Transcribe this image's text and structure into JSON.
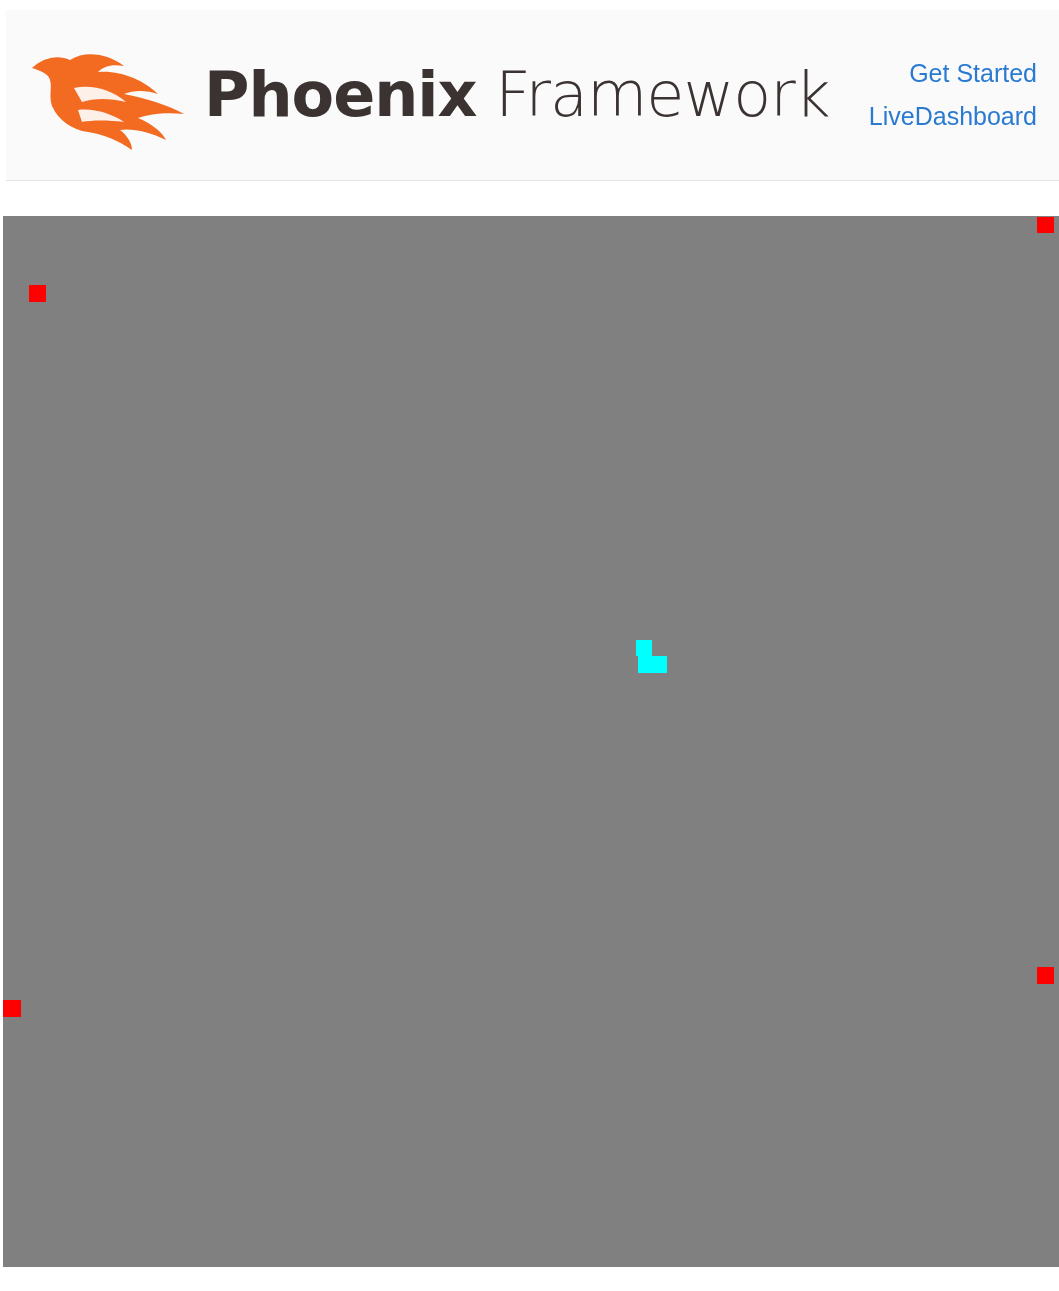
{
  "header": {
    "logo": {
      "bold": "Phoenix",
      "light": "Framework"
    },
    "links": [
      {
        "label": "Get Started"
      },
      {
        "label": "LiveDashboard"
      }
    ]
  },
  "board": {
    "kind": "game-board"
  }
}
